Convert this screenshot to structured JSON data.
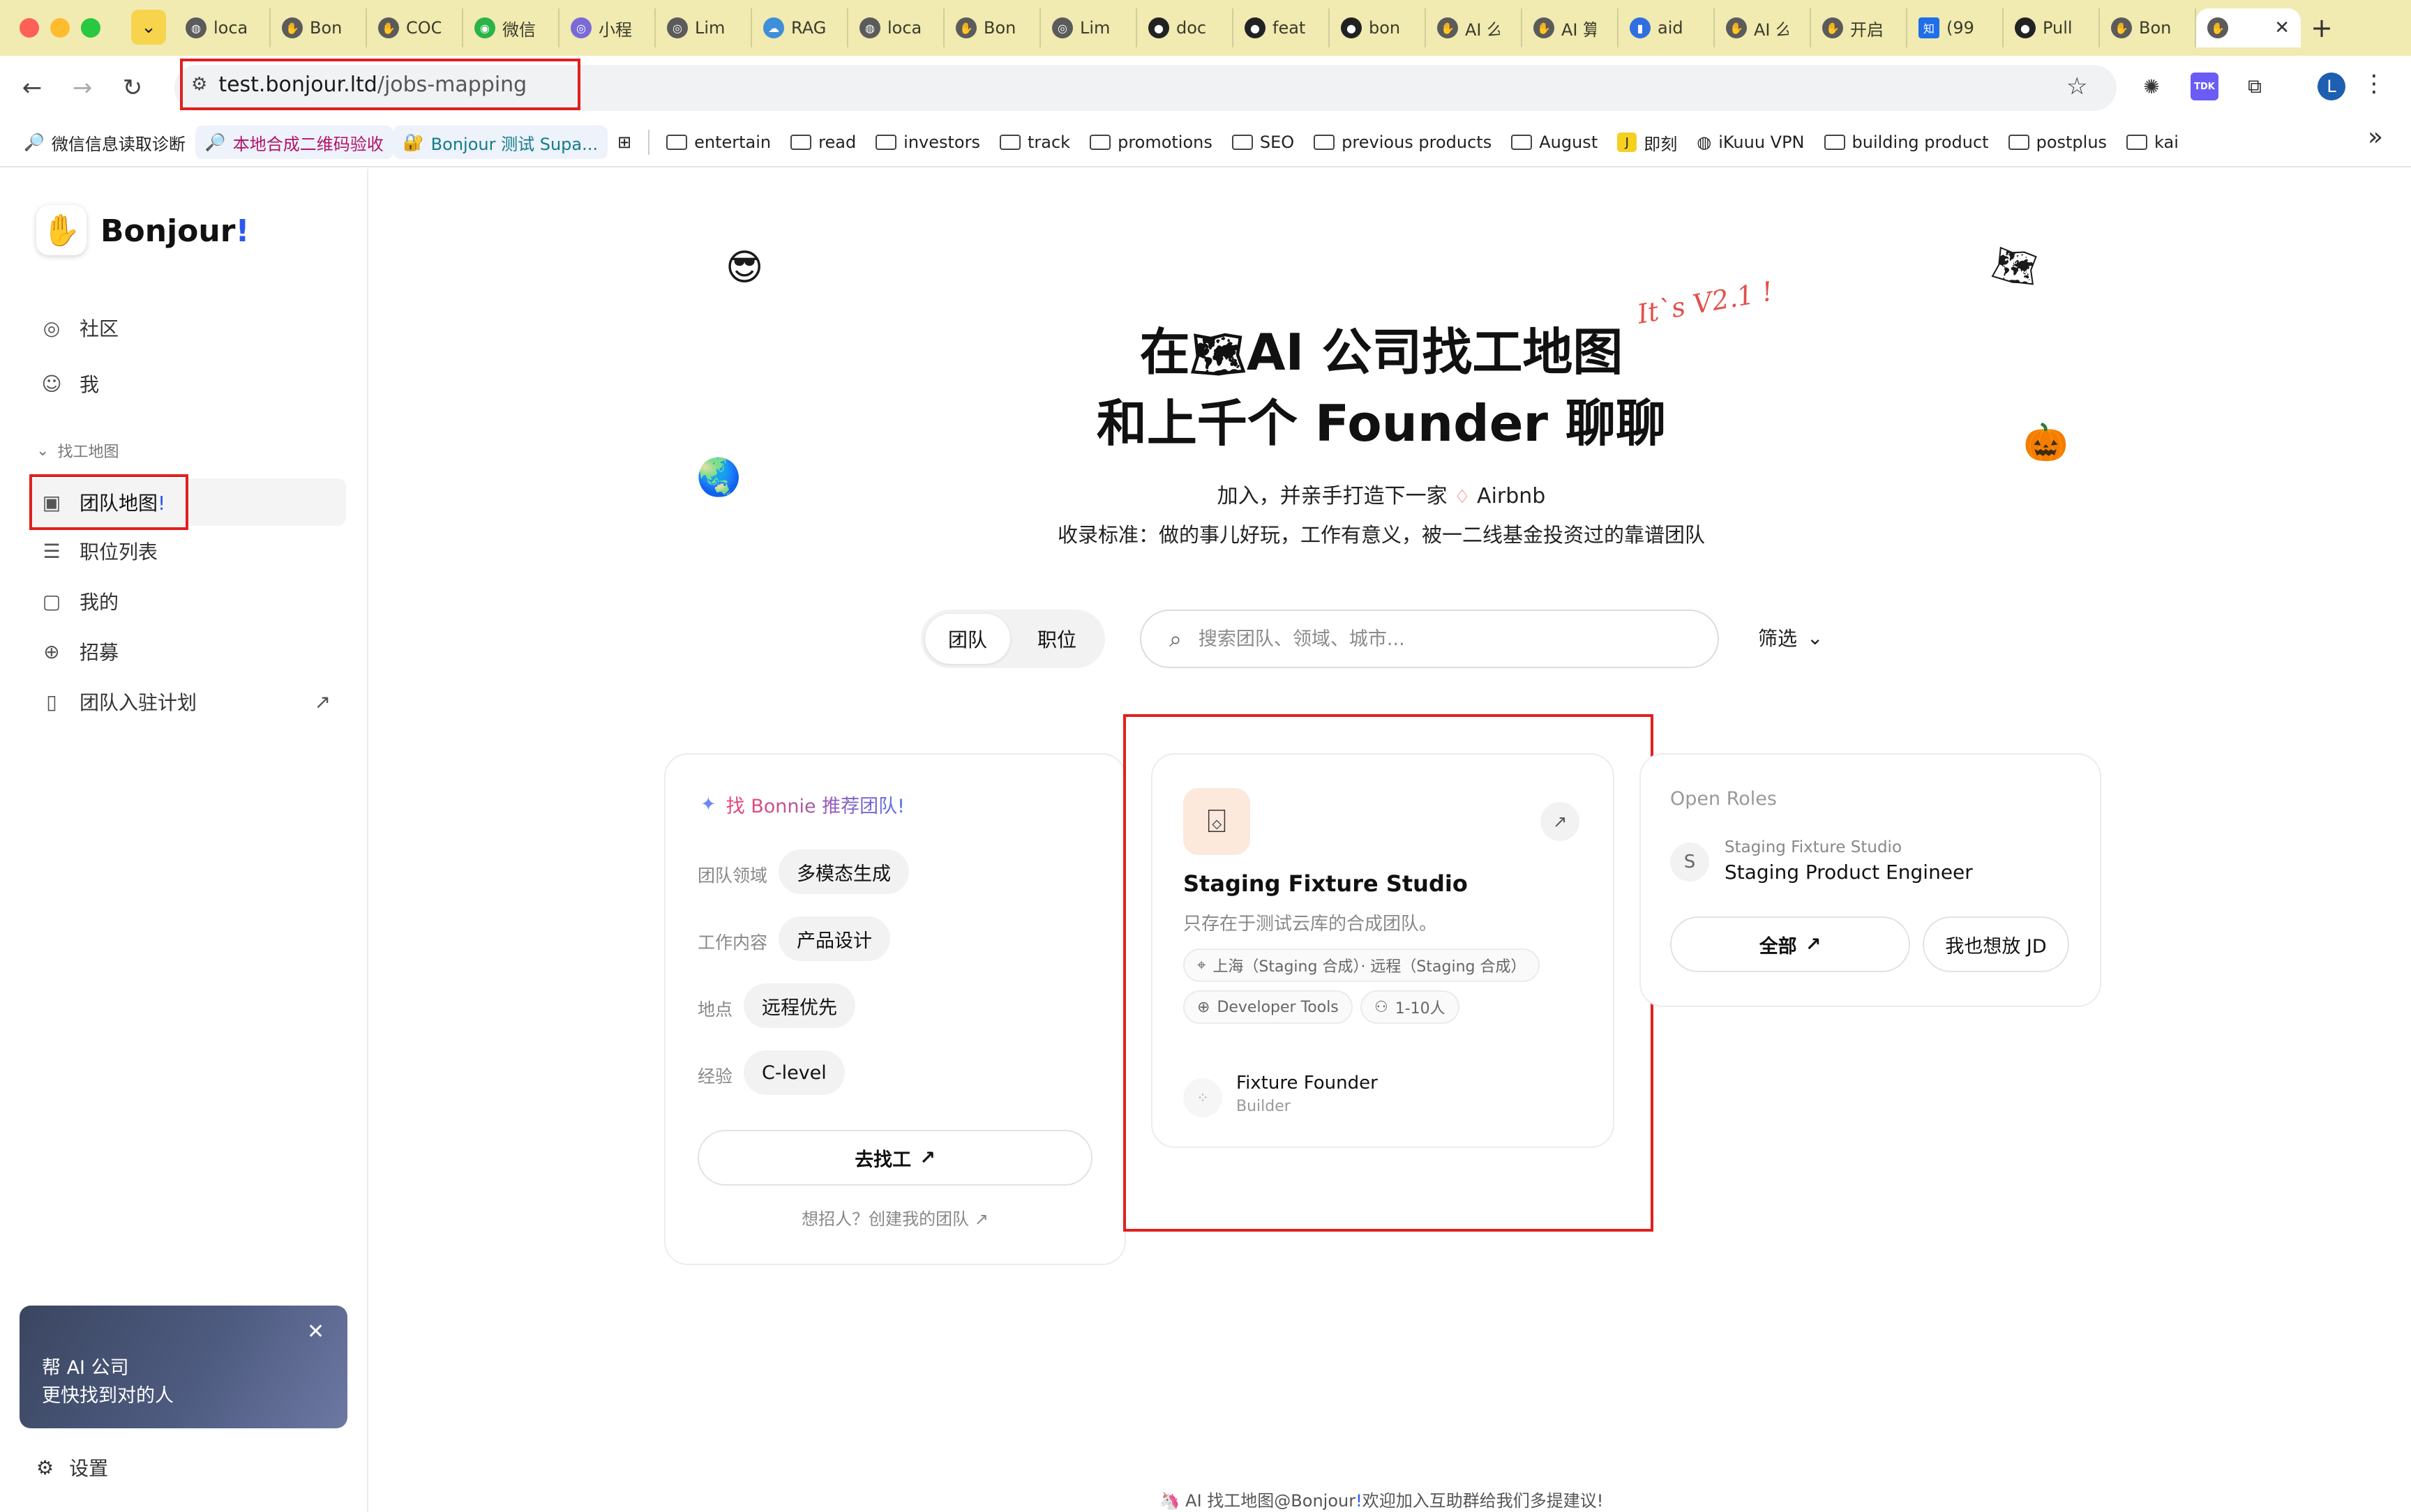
{
  "browser": {
    "tabs": [
      {
        "label": "loca",
        "icon": "globe-icon"
      },
      {
        "label": "Bon",
        "icon": "bonjour-icon"
      },
      {
        "label": "COC",
        "icon": "bonjour-icon"
      },
      {
        "label": "微信",
        "icon": "wechat-icon"
      },
      {
        "label": "小程",
        "icon": "app-icon"
      },
      {
        "label": "Lim",
        "icon": "app-icon"
      },
      {
        "label": "RAG",
        "icon": "cloud-icon"
      },
      {
        "label": "loca",
        "icon": "globe-icon"
      },
      {
        "label": "Bon",
        "icon": "bonjour-icon"
      },
      {
        "label": "Lim",
        "icon": "app-icon"
      },
      {
        "label": "doc",
        "icon": "github-icon"
      },
      {
        "label": "feat",
        "icon": "github-icon"
      },
      {
        "label": "bon",
        "icon": "github-icon"
      },
      {
        "label": "AI 么",
        "icon": "bonjour-icon"
      },
      {
        "label": "AI 算",
        "icon": "bonjour-icon"
      },
      {
        "label": "aid",
        "icon": "chart-icon"
      },
      {
        "label": "AI 么",
        "icon": "bonjour-icon"
      },
      {
        "label": "开启",
        "icon": "bonjour-icon"
      },
      {
        "label": "(99",
        "icon": "zhihu-icon"
      },
      {
        "label": "Pull",
        "icon": "github-icon"
      },
      {
        "label": "Bon",
        "icon": "bonjour-icon"
      }
    ],
    "url_domain": "test.bonjour.ltd",
    "url_path": "/jobs-mapping",
    "avatar_letter": "L",
    "ext_tdk": "TDK",
    "bookmarks": {
      "b1": "微信信息读取诊断",
      "b2": "本地合成二维码验收",
      "b3": "Bonjour 测试 Supa...",
      "folders": [
        "entertain",
        "read",
        "investors",
        "track",
        "promotions",
        "SEO",
        "previous products",
        "August"
      ],
      "b_jike": "即刻",
      "b_vpn": "iKuuu VPN",
      "folders2": [
        "building product",
        "postplus",
        "kai"
      ]
    }
  },
  "sidebar": {
    "logo": "Bonjour",
    "logo_ex": "!",
    "items": [
      {
        "label": "社区",
        "icon": "compass-icon"
      },
      {
        "label": "我",
        "icon": "smile-icon"
      }
    ],
    "section": "找工地图",
    "section_items": [
      {
        "label": "团队地图",
        "ex": "!",
        "icon": "map-icon"
      },
      {
        "label": "职位列表",
        "icon": "list-icon"
      },
      {
        "label": "我的",
        "icon": "bookmark-icon"
      },
      {
        "label": "招募",
        "icon": "plus-circle-icon"
      },
      {
        "label": "团队入驻计划",
        "icon": "book-icon"
      }
    ],
    "promo_line1": "帮 AI 公司",
    "promo_line2": "更快找到对的人",
    "settings": "设置"
  },
  "hero": {
    "title_line1_a": "在",
    "title_line1_b": "AI 公司找工地图",
    "title_line2": "和上千个 Founder 聊聊",
    "version": "It`s V2.1 !",
    "sub1_a": "加入，并亲手打造下一家",
    "sub1_b": "Airbnb",
    "sub2": "收录标准：做的事儿好玩，工作有意义，被一二线基金投资过的靠谱团队"
  },
  "search": {
    "seg_team": "团队",
    "seg_role": "职位",
    "placeholder": "搜索团队、领域、城市...",
    "filter": "筛选"
  },
  "bonnie_card": {
    "title_a": "找",
    "title_b": "Bonnie 推荐团队!",
    "rows": [
      {
        "label": "团队领域",
        "value": "多模态生成"
      },
      {
        "label": "工作内容",
        "value": "产品设计"
      },
      {
        "label": "地点",
        "value": "远程优先"
      },
      {
        "label": "经验",
        "value": "C-level"
      }
    ],
    "cta": "去找工",
    "hint": "想招人？创建我的团队"
  },
  "studio_card": {
    "name": "Staging Fixture Studio",
    "desc": "只存在于测试云库的合成团队。",
    "location": "上海（Staging 合成）· 远程（Staging 合成）",
    "industry": "Developer Tools",
    "size": "1-10人",
    "founder_name": "Fixture Founder",
    "founder_role": "Builder"
  },
  "roles_card": {
    "title": "Open Roles",
    "avatar": "S",
    "company": "Staging Fixture Studio",
    "role": "Staging Product Engineer",
    "btn_all": "全部",
    "btn_jd": "我也想放 JD"
  },
  "footer": {
    "a": "AI 找工地图@Bonjour",
    "ex": "!",
    "b": "欢迎加入互助群给我们多提建议!"
  }
}
